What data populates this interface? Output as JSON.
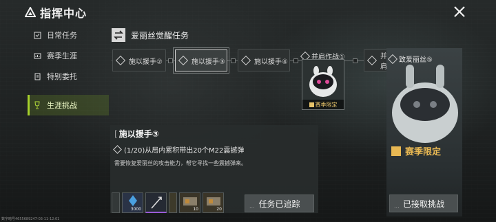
{
  "header": {
    "title": "指挥中心"
  },
  "sidebar": {
    "items": [
      {
        "label": "日常任务",
        "icon": "checklist-icon"
      },
      {
        "label": "赛季生涯",
        "icon": "career-icon"
      },
      {
        "label": "特别委托",
        "icon": "commission-icon"
      },
      {
        "label": "生涯挑战",
        "icon": "trophy-icon"
      }
    ]
  },
  "section": {
    "title": "爱丽丝觉醒任务"
  },
  "chain": {
    "nodes": [
      "施以援手②",
      "施以援手③",
      "施以援手④",
      "并肩作战①",
      "并肩"
    ]
  },
  "reward": {
    "title": "并肩作战①",
    "badge": "赛季限定"
  },
  "right_panel": {
    "title": "致爱丽丝⑤",
    "badge": "赛季限定",
    "button": "已接取挑战"
  },
  "task": {
    "bracket": "[",
    "title": "施以援手③",
    "objective": "(1/20)从局内累积带出20个M22震撼弹",
    "description": "需要恢复爱丽丝的攻击能力，帮它寻找一些震撼弹来。",
    "track_button": "任务已追踪"
  },
  "items": [
    {
      "count": "3000"
    },
    {
      "count": ""
    },
    {
      "count": "10"
    },
    {
      "count": "20"
    }
  ],
  "footer": {
    "text": "数字暗号4655689247-03-11-12:01"
  },
  "colors": {
    "accent": "#a6d12b",
    "season": "#e8b853"
  }
}
